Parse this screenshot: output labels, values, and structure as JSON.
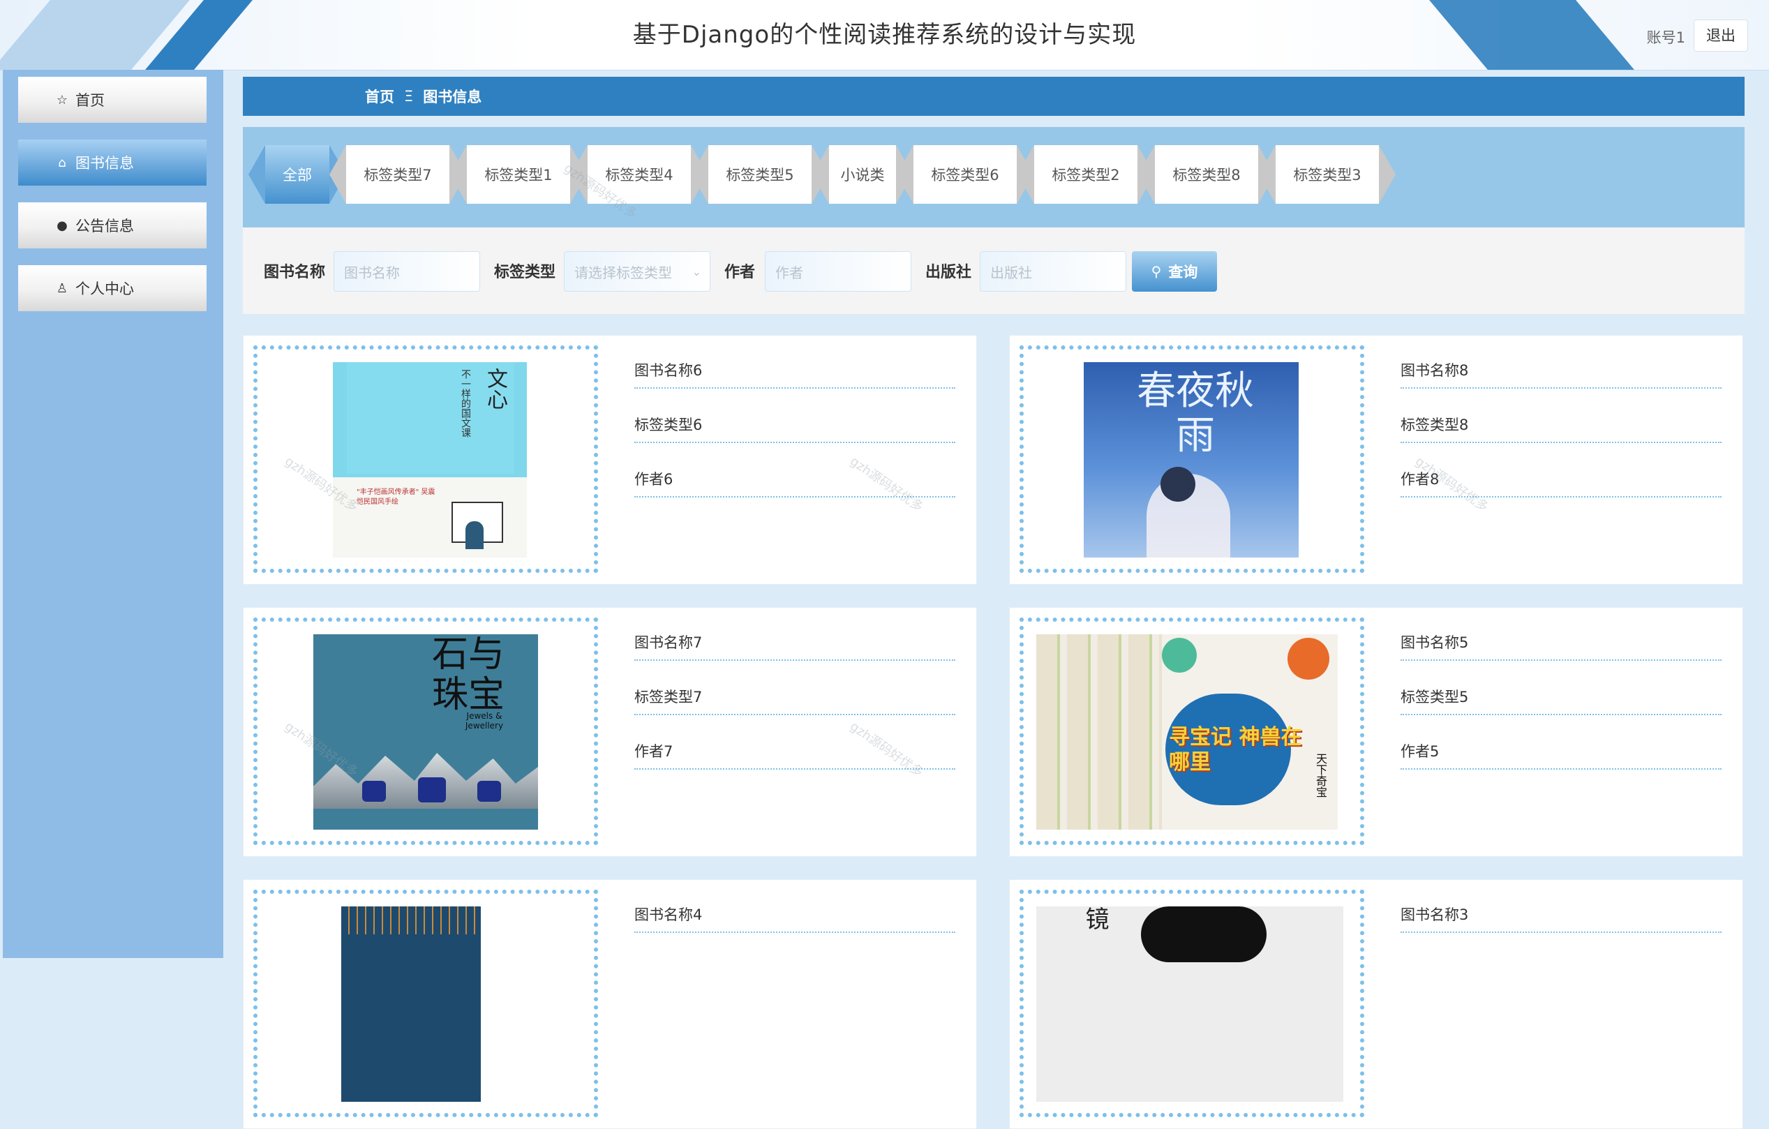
{
  "header": {
    "title": "基于Django的个性阅读推荐系统的设计与实现",
    "account": "账号1",
    "logout": "退出"
  },
  "sidebar": {
    "items": [
      {
        "label": "首页",
        "icon": "star-icon"
      },
      {
        "label": "图书信息",
        "icon": "bag-icon",
        "active": true
      },
      {
        "label": "公告信息",
        "icon": "alert-icon"
      },
      {
        "label": "个人中心",
        "icon": "user-icon"
      }
    ]
  },
  "breadcrumb": {
    "home": "首页",
    "separator": "Ξ",
    "current": "图书信息"
  },
  "tabs": [
    "全部",
    "标签类型7",
    "标签类型1",
    "标签类型4",
    "标签类型5",
    "小说类",
    "标签类型6",
    "标签类型2",
    "标签类型8",
    "标签类型3"
  ],
  "search": {
    "name_label": "图书名称",
    "name_placeholder": "图书名称",
    "type_label": "标签类型",
    "type_placeholder": "请选择标签类型",
    "author_label": "作者",
    "author_placeholder": "作者",
    "publisher_label": "出版社",
    "publisher_placeholder": "出版社",
    "button": "查询"
  },
  "books": [
    {
      "name": "图书名称6",
      "tag": "标签类型6",
      "author": "作者6"
    },
    {
      "name": "图书名称8",
      "tag": "标签类型8",
      "author": "作者8"
    },
    {
      "name": "图书名称7",
      "tag": "标签类型7",
      "author": "作者7"
    },
    {
      "name": "图书名称5",
      "tag": "标签类型5",
      "author": "作者5"
    },
    {
      "name": "图书名称4",
      "tag": "",
      "author": ""
    },
    {
      "name": "图书名称3",
      "tag": "",
      "author": ""
    }
  ],
  "covers": [
    {
      "title": "文心",
      "subtitle": "不一样的国文课",
      "tagline": "\"丰子恺画风传承者\" 吴震恺民国风手绘"
    },
    {
      "title": "春夜秋雨"
    },
    {
      "title": "石与珠宝",
      "subtitle": "Jewels & Jewellery"
    },
    {
      "title": "寻宝记 神兽在哪里",
      "subtitle": "天下奇宝"
    },
    {
      "title": ""
    },
    {
      "title": "镜"
    }
  ],
  "watermark": "gzh源码好优多",
  "colors": {
    "primary": "#2f80c0",
    "sidebar": "#8fbce6",
    "tabs_bg": "#97c7e8",
    "dotted": "#7cc0ea"
  }
}
